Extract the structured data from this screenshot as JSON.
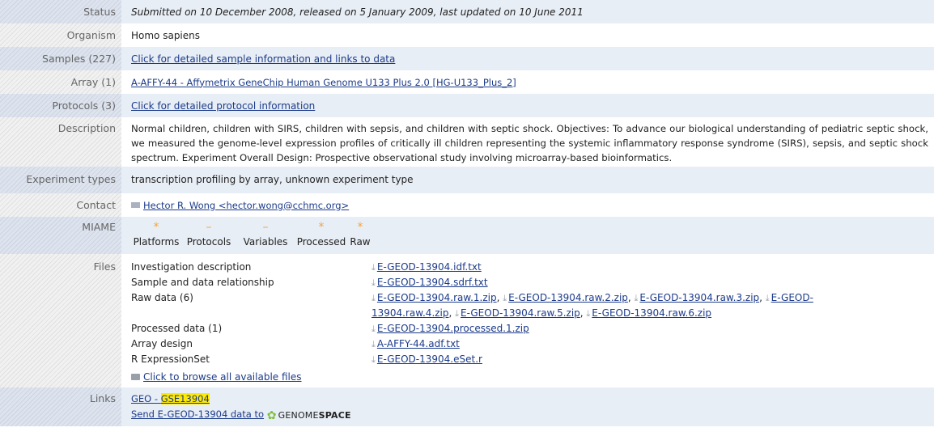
{
  "status": {
    "label": "Status",
    "text": "Submitted on 10 December 2008, released on 5 January 2009, last updated on 10 June 2011"
  },
  "organism": {
    "label": "Organism",
    "text": "Homo sapiens"
  },
  "samples": {
    "label": "Samples (227)",
    "link": "Click for detailed sample information and links to data"
  },
  "array": {
    "label": "Array (1)",
    "link": "A-AFFY-44 - Affymetrix GeneChip Human Genome U133 Plus 2.0 [HG-U133_Plus_2]"
  },
  "protocols": {
    "label": "Protocols (3)",
    "link": "Click for detailed protocol information"
  },
  "description": {
    "label": "Description",
    "text": "Normal children, children with SIRS, children with sepsis, and children with septic shock. Objectives: To advance our biological understanding of pediatric septic shock, we measured the genome-level expression profiles of critically ill children representing the systemic inflammatory response syndrome (SIRS), sepsis, and septic shock spectrum. Experiment Overall Design: Prospective observational study involving microarray-based bioinformatics."
  },
  "experiment_types": {
    "label": "Experiment types",
    "text": "transcription profiling by array, unknown experiment type"
  },
  "contact": {
    "label": "Contact",
    "link": "Hector R. Wong <hector.wong@cchmc.org>",
    "icon": "envelope-icon"
  },
  "miame": {
    "label": "MIAME",
    "items": [
      {
        "symbol": "*",
        "label": "Platforms"
      },
      {
        "symbol": "–",
        "label": "Protocols"
      },
      {
        "symbol": "–",
        "label": "Variables"
      },
      {
        "symbol": "*",
        "label": "Processed"
      },
      {
        "symbol": "*",
        "label": "Raw"
      }
    ],
    "accent_color": "#f2a53c"
  },
  "files": {
    "label": "Files",
    "rows": [
      {
        "name": "Investigation description",
        "links": [
          "E-GEOD-13904.idf.txt"
        ]
      },
      {
        "name": "Sample and data relationship",
        "links": [
          "E-GEOD-13904.sdrf.txt"
        ]
      },
      {
        "name": "Raw data (6)",
        "line1": [
          "E-GEOD-13904.raw.1.zip",
          "E-GEOD-13904.raw.2.zip",
          "E-GEOD-13904.raw.3.zip",
          "E-GEOD-"
        ],
        "line2": [
          "13904.raw.4.zip",
          "E-GEOD-13904.raw.5.zip",
          "E-GEOD-13904.raw.6.zip"
        ]
      },
      {
        "name": "Processed data (1)",
        "links": [
          "E-GEOD-13904.processed.1.zip"
        ]
      },
      {
        "name": "Array design",
        "links": [
          "A-AFFY-44.adf.txt"
        ]
      },
      {
        "name": "R ExpressionSet",
        "links": [
          "E-GEOD-13904.eSet.r"
        ]
      }
    ],
    "browse_link": "Click to browse all available files",
    "download_icon": "download-icon",
    "folder_icon": "folder-icon"
  },
  "links": {
    "label": "Links",
    "geo_prefix": "GEO - ",
    "geo_id": "GSE13904",
    "send_text": "Send E-GEOD-13904 data to",
    "genomespace": {
      "light": "GENOME",
      "bold": "SPACE"
    }
  },
  "colors": {
    "link": "#1c3b8a",
    "row_alt": "#e8eef6",
    "highlight": "#ffea00"
  }
}
